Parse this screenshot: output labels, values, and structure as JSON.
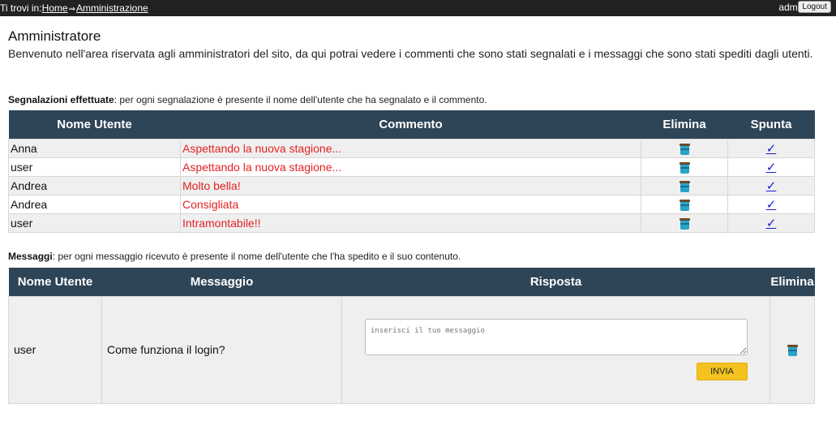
{
  "topbar": {
    "breadcrumb_prefix": "Ti trovi in:",
    "breadcrumb_home": "Home",
    "breadcrumb_sep": "⇒",
    "breadcrumb_current": "Amministrazione",
    "username": "admin",
    "logout_label": "Logout"
  },
  "header": {
    "title": "Amministratore",
    "intro": "Benvenuto nell'area riservata agli amministratori del sito, da qui potrai vedere i commenti che sono stati segnalati e i messaggi che sono stati spediti dagli utenti."
  },
  "reports": {
    "caption_bold": "Segnalazioni effettuate",
    "caption_rest": ": per ogni segnalazione è presente il nome dell'utente che ha segnalato e il commento.",
    "columns": [
      "Nome Utente",
      "Commento",
      "Elimina",
      "Spunta"
    ],
    "rows": [
      {
        "user": "Anna",
        "comment": "Aspettando la nuova stagione..."
      },
      {
        "user": "user",
        "comment": "Aspettando la nuova stagione..."
      },
      {
        "user": "Andrea",
        "comment": "Molto bella!"
      },
      {
        "user": "Andrea",
        "comment": "Consigliata"
      },
      {
        "user": "user",
        "comment": "Intramontabile!!"
      }
    ],
    "check_glyph": "✓"
  },
  "messages": {
    "caption_bold": "Messaggi",
    "caption_rest": ": per ogni messaggio ricevuto è presente il nome dell'utente che l'ha spedito e il suo contenuto.",
    "columns": [
      "Nome Utente",
      "Messaggio",
      "Risposta",
      "Elimina"
    ],
    "rows": [
      {
        "user": "user",
        "message": "Come funziona il login?"
      }
    ],
    "reply_placeholder": "inserisci il tuo messaggio",
    "send_label": "INVIA"
  },
  "icons": {
    "delete": "trash-icon",
    "check": "check-icon"
  },
  "colors": {
    "header_bg": "#2e4457",
    "topbar_bg": "#222222",
    "comment_text": "#e32222",
    "check_link": "#1a1ad6",
    "send_button": "#f4c21f"
  }
}
